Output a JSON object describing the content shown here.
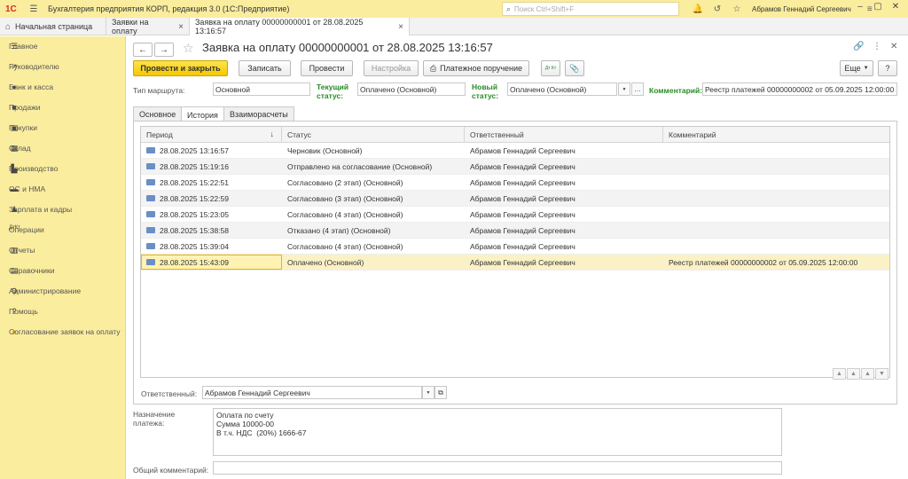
{
  "titlebar": {
    "logo": "1С",
    "app_title": "Бухгалтерия предприятия КОРП, редакция 3.0  (1С:Предприятие)",
    "search_placeholder": "Поиск Ctrl+Shift+F",
    "user": "Абрамов Геннадий Сергеевич"
  },
  "tabs": {
    "home": "Начальная страница",
    "items": [
      {
        "label": "Заявки на оплату"
      },
      {
        "label": "Заявка на оплату  00000000001 от 28.08.2025 13:16:57"
      }
    ]
  },
  "sidebar": {
    "items": [
      {
        "label": "Главное",
        "icon": "menu-icon"
      },
      {
        "label": "Руководителю",
        "icon": "trend-icon"
      },
      {
        "label": "Банк и касса",
        "icon": "bank-icon"
      },
      {
        "label": "Продажи",
        "icon": "bag-icon"
      },
      {
        "label": "Покупки",
        "icon": "cart-icon"
      },
      {
        "label": "Склад",
        "icon": "warehouse-icon"
      },
      {
        "label": "Производство",
        "icon": "factory-icon"
      },
      {
        "label": "ОС и НМА",
        "icon": "truck-icon"
      },
      {
        "label": "Зарплата и кадры",
        "icon": "people-icon"
      },
      {
        "label": "Операции",
        "icon": "dt-kt-icon"
      },
      {
        "label": "Отчеты",
        "icon": "chart-icon"
      },
      {
        "label": "Справочники",
        "icon": "book-icon"
      },
      {
        "label": "Администрирование",
        "icon": "gear-icon"
      },
      {
        "label": "Помощь",
        "icon": "help-icon"
      },
      {
        "label": "Согласование заявок на оплату",
        "icon": "approval-icon"
      }
    ]
  },
  "document": {
    "title": "Заявка на оплату  00000000001 от 28.08.2025 13:16:57"
  },
  "toolbar": {
    "post_close": "Провести и закрыть",
    "save": "Записать",
    "post": "Провести",
    "settings": "Настройка",
    "payment_order": "Платежное поручение",
    "dtkt": "Дт Кт",
    "more": "Еще"
  },
  "header_fields": {
    "route_type_label": "Тип маршрута:",
    "route_type_value": "Основной",
    "current_status_label": "Текущий статус:",
    "current_status_value": "Оплачено (Основной)",
    "new_status_label": "Новый статус:",
    "new_status_value": "Оплачено (Основной)",
    "comment_label": "Комментарий:",
    "comment_value": "Реестр платежей  00000000002 от 05.09.2025 12:00:00"
  },
  "form_tabs": [
    {
      "label": "Основное"
    },
    {
      "label": "История"
    },
    {
      "label": "Взаиморасчеты"
    }
  ],
  "history": {
    "columns": [
      "Период",
      "Статус",
      "Ответственный",
      "Комментарий"
    ],
    "rows": [
      {
        "period": "28.08.2025 13:16:57",
        "status": "Черновик (Основной)",
        "responsible": "Абрамов Геннадий Сергеевич",
        "comment": ""
      },
      {
        "period": "28.08.2025 15:19:16",
        "status": "Отправлено на согласование (Основной)",
        "responsible": "Абрамов Геннадий Сергеевич",
        "comment": ""
      },
      {
        "period": "28.08.2025 15:22:51",
        "status": "Согласовано (2 этап) (Основной)",
        "responsible": "Абрамов Геннадий Сергеевич",
        "comment": ""
      },
      {
        "period": "28.08.2025 15:22:59",
        "status": "Согласовано (3 этап) (Основной)",
        "responsible": "Абрамов Геннадий Сергеевич",
        "comment": ""
      },
      {
        "period": "28.08.2025 15:23:05",
        "status": "Согласовано (4 этап) (Основной)",
        "responsible": "Абрамов Геннадий Сергеевич",
        "comment": ""
      },
      {
        "period": "28.08.2025 15:38:58",
        "status": "Отказано (4 этап) (Основной)",
        "responsible": "Абрамов Геннадий Сергеевич",
        "comment": ""
      },
      {
        "period": "28.08.2025 15:39:04",
        "status": "Согласовано (4 этап) (Основной)",
        "responsible": "Абрамов Геннадий Сергеевич",
        "comment": ""
      },
      {
        "period": "28.08.2025 15:43:09",
        "status": "Оплачено (Основной)",
        "responsible": "Абрамов Геннадий Сергеевич",
        "comment": "Реестр платежей  00000000002 от 05.09.2025 12:00:00"
      }
    ]
  },
  "responsible": {
    "label": "Ответственный:",
    "value": "Абрамов Геннадий Сергеевич"
  },
  "purpose": {
    "label": "Назначение платежа:",
    "value": "Оплата по счету\nСумма 10000-00\nВ т.ч. НДС  (20%) 1666-67"
  },
  "general_comment": {
    "label": "Общий комментарий:",
    "value": ""
  }
}
